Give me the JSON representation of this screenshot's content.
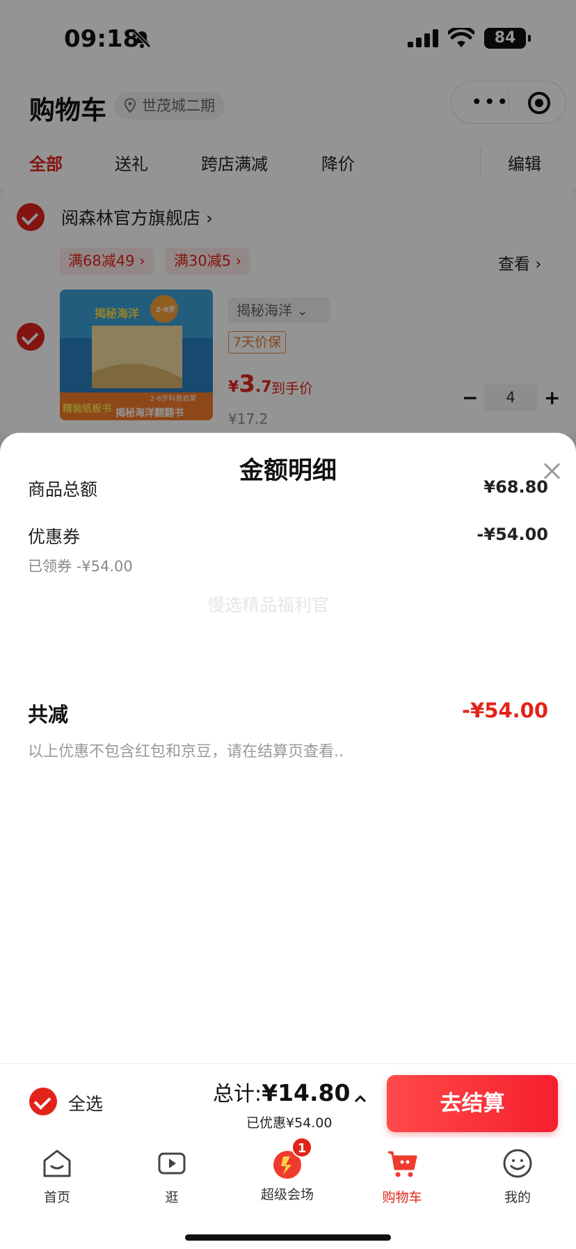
{
  "status_bar": {
    "time": "09:18",
    "battery": "84"
  },
  "header": {
    "title": "购物车",
    "location": "世茂城二期",
    "tabs": [
      "全部",
      "送礼",
      "跨店满减",
      "降价"
    ],
    "edit": "编辑"
  },
  "store": {
    "name": "阅森林官方旗舰店",
    "promos": [
      "满68减49",
      "满30减5"
    ],
    "view_more": "查看",
    "item": {
      "variant": "揭秘海洋",
      "price_protect": "7天价保",
      "deal_currency": "¥",
      "deal_int": "3",
      "deal_dec": ".7",
      "deal_label": "到手价",
      "orig_price": "¥17.2",
      "qty": "4",
      "book_title": "揭秘海洋",
      "book_age": "2-6岁",
      "book_badge": "精装纸板书",
      "book_subtitle": "揭秘海洋翻翻书",
      "book_range": "2-6岁科普启蒙"
    }
  },
  "sheet": {
    "title": "金额明细",
    "watermark": "慢选精品福利官",
    "rows": [
      {
        "label": "商品总额",
        "value": "¥68.80"
      },
      {
        "label": "优惠券",
        "value": "-¥54.00",
        "sub": "已领券 -¥54.00"
      }
    ],
    "total_label": "共减",
    "total_value": "-¥54.00",
    "note": "以上优惠不包含红包和京豆，请在结算页查看.."
  },
  "checkout": {
    "select_all": "全选",
    "total_prefix": "总计:",
    "total_amount": "¥14.80",
    "saved": "已优惠¥54.00",
    "button": "去结算"
  },
  "tabbar": {
    "items": [
      "首页",
      "逛",
      "超级会场",
      "购物车",
      "我的"
    ],
    "badge": "1",
    "active_index": 3
  },
  "colors": {
    "accent": "#e2231a",
    "button": "#f51f2e"
  }
}
